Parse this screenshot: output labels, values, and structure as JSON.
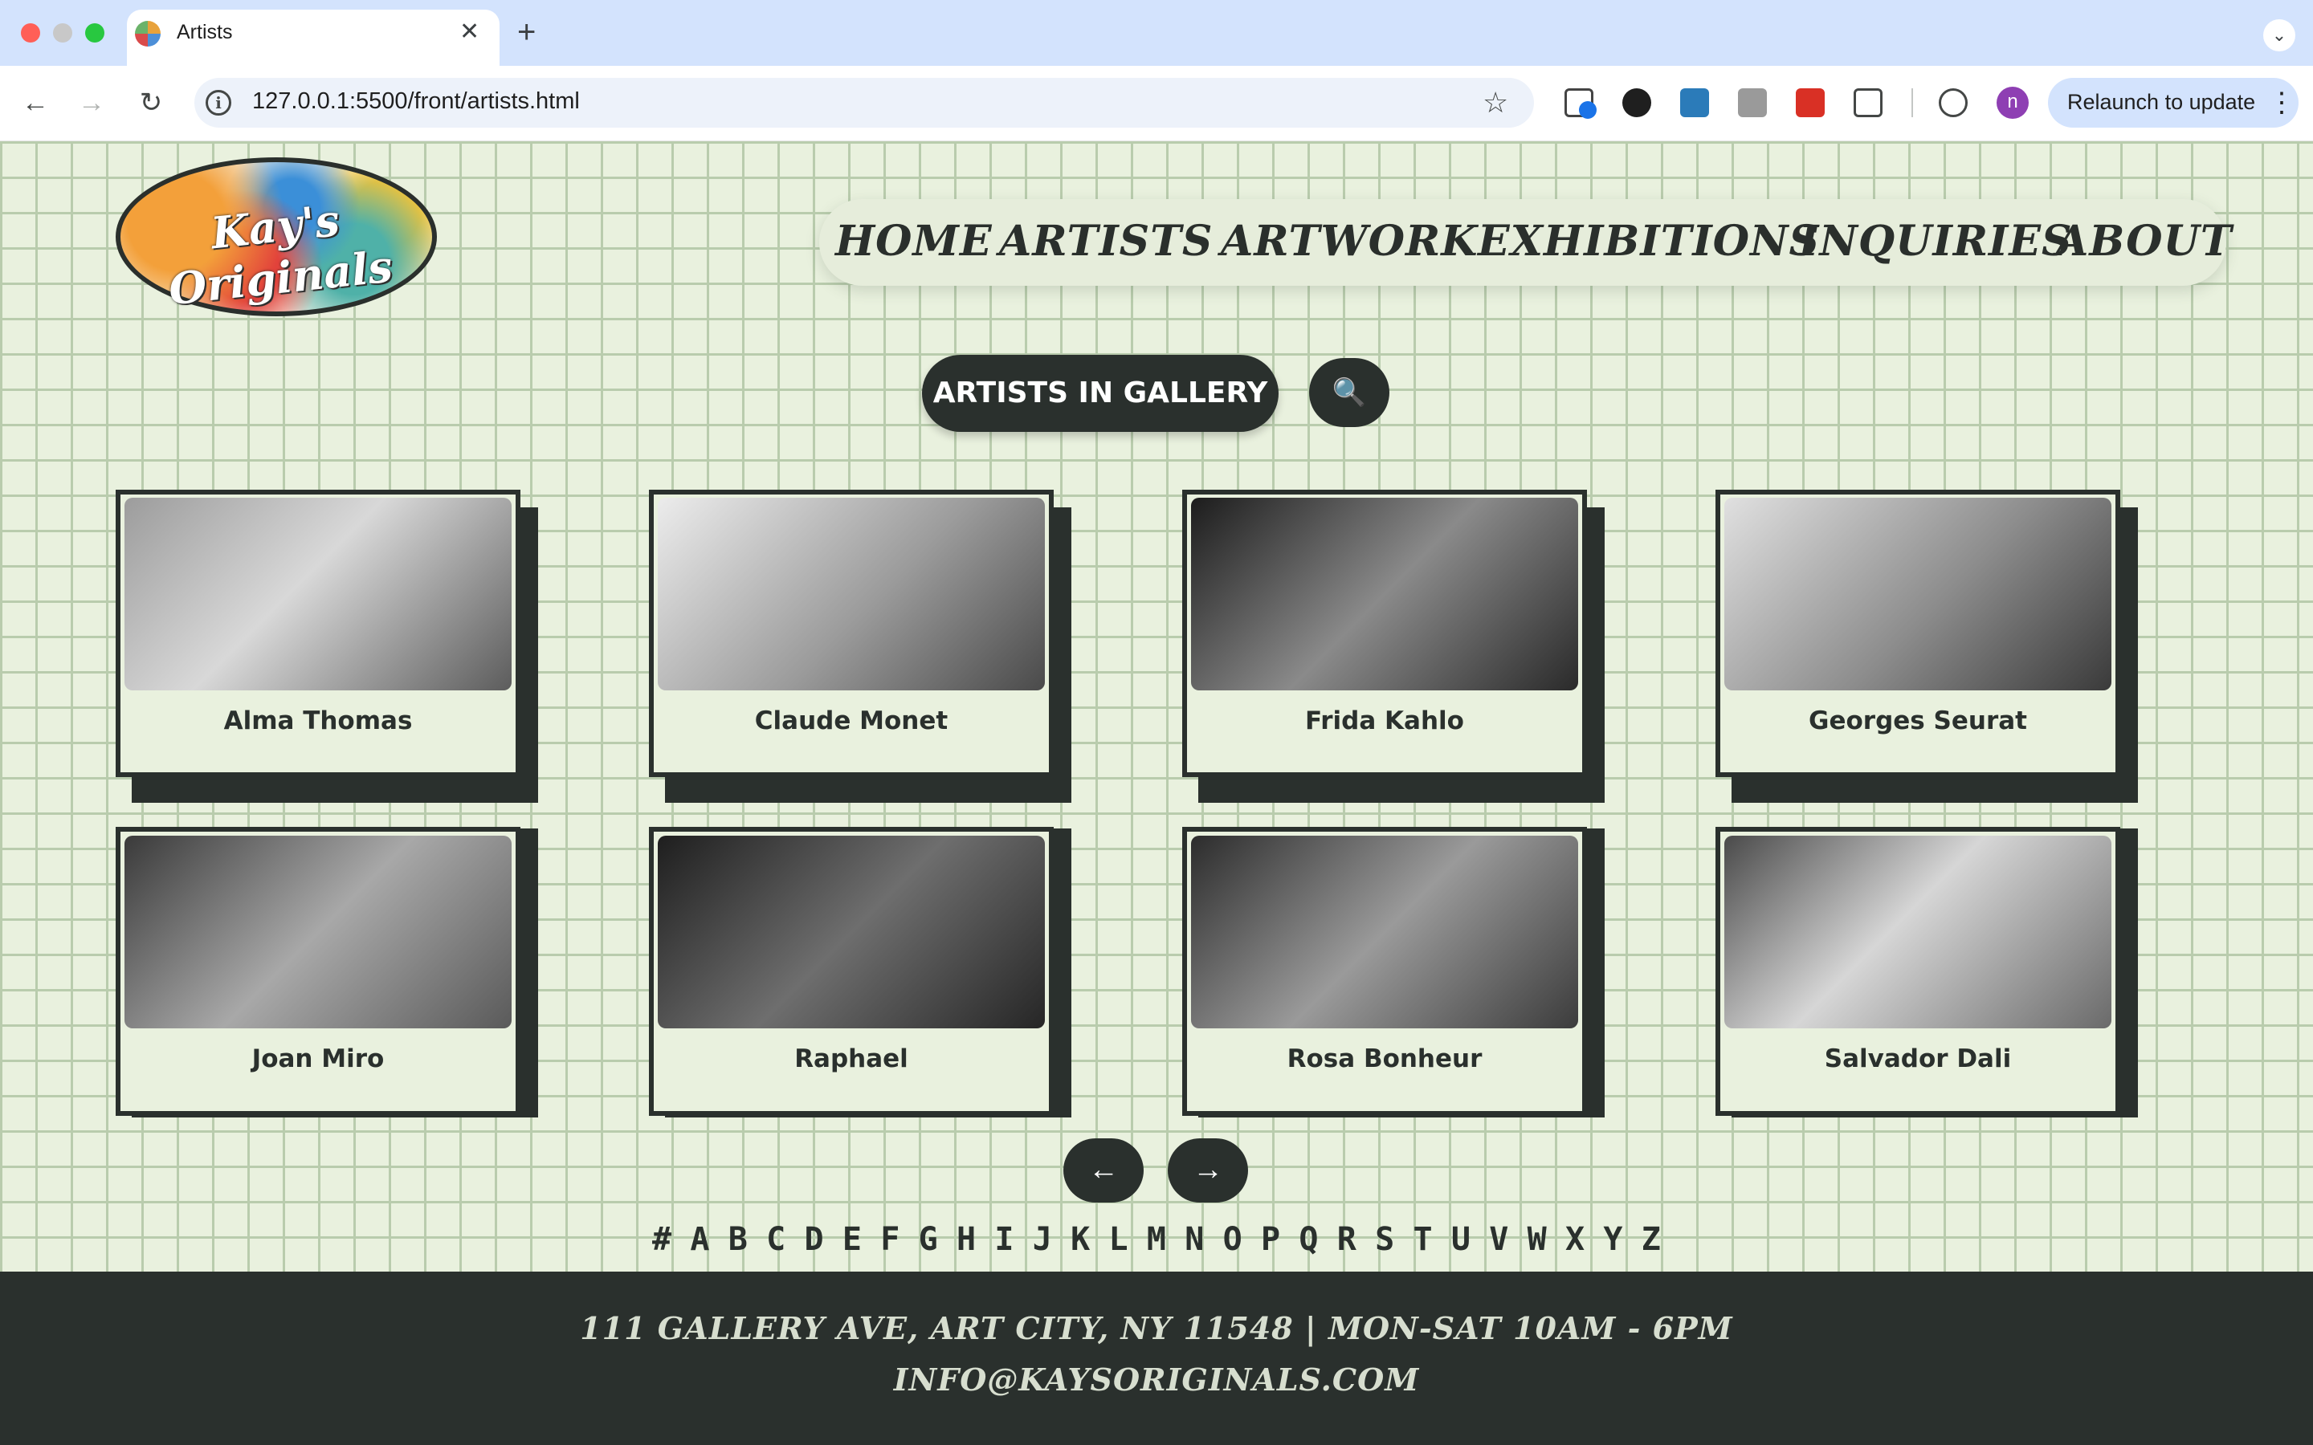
{
  "browser": {
    "tab_title": "Artists",
    "new_tab": "+",
    "tab_close": "✕",
    "url": "127.0.0.1:5500/front/artists.html",
    "profile_initial": "n",
    "relaunch_label": "Relaunch to update",
    "tabs_menu": "⌄"
  },
  "site": {
    "logo_text": "Kay's Originals",
    "nav": [
      "HOME",
      "ARTISTS",
      "ARTWORK",
      "EXHIBITIONS",
      "INQUIRIES",
      "ABOUT"
    ],
    "heading": "ARTISTS IN GALLERY",
    "search_icon": "🔍"
  },
  "artists": [
    {
      "name": "Alma Thomas",
      "icon": "portrait-photo"
    },
    {
      "name": "Claude Monet",
      "icon": "portrait-photo"
    },
    {
      "name": "Frida Kahlo",
      "icon": "portrait-photo"
    },
    {
      "name": "Georges Seurat",
      "icon": "portrait-photo"
    },
    {
      "name": "Joan Miro",
      "icon": "portrait-photo"
    },
    {
      "name": "Raphael",
      "icon": "portrait-photo"
    },
    {
      "name": "Rosa Bonheur",
      "icon": "portrait-photo"
    },
    {
      "name": "Salvador Dali",
      "icon": "portrait-photo"
    }
  ],
  "pagination": {
    "prev": "←",
    "next": "→"
  },
  "alphabet": [
    "#",
    "A",
    "B",
    "C",
    "D",
    "E",
    "F",
    "G",
    "H",
    "I",
    "J",
    "K",
    "L",
    "M",
    "N",
    "O",
    "P",
    "Q",
    "R",
    "S",
    "T",
    "U",
    "V",
    "W",
    "X",
    "Y",
    "Z"
  ],
  "footer": {
    "address": "111 GALLERY AVE, ART CITY, NY 11548 | MON-SAT 10AM - 6PM",
    "email": "INFO@KAYSORIGINALS.COM"
  },
  "colors": {
    "dark": "#2a302d",
    "page_bg": "#e9f1de",
    "grid": "#b9ccad",
    "chrome": "#d3e3fd"
  }
}
